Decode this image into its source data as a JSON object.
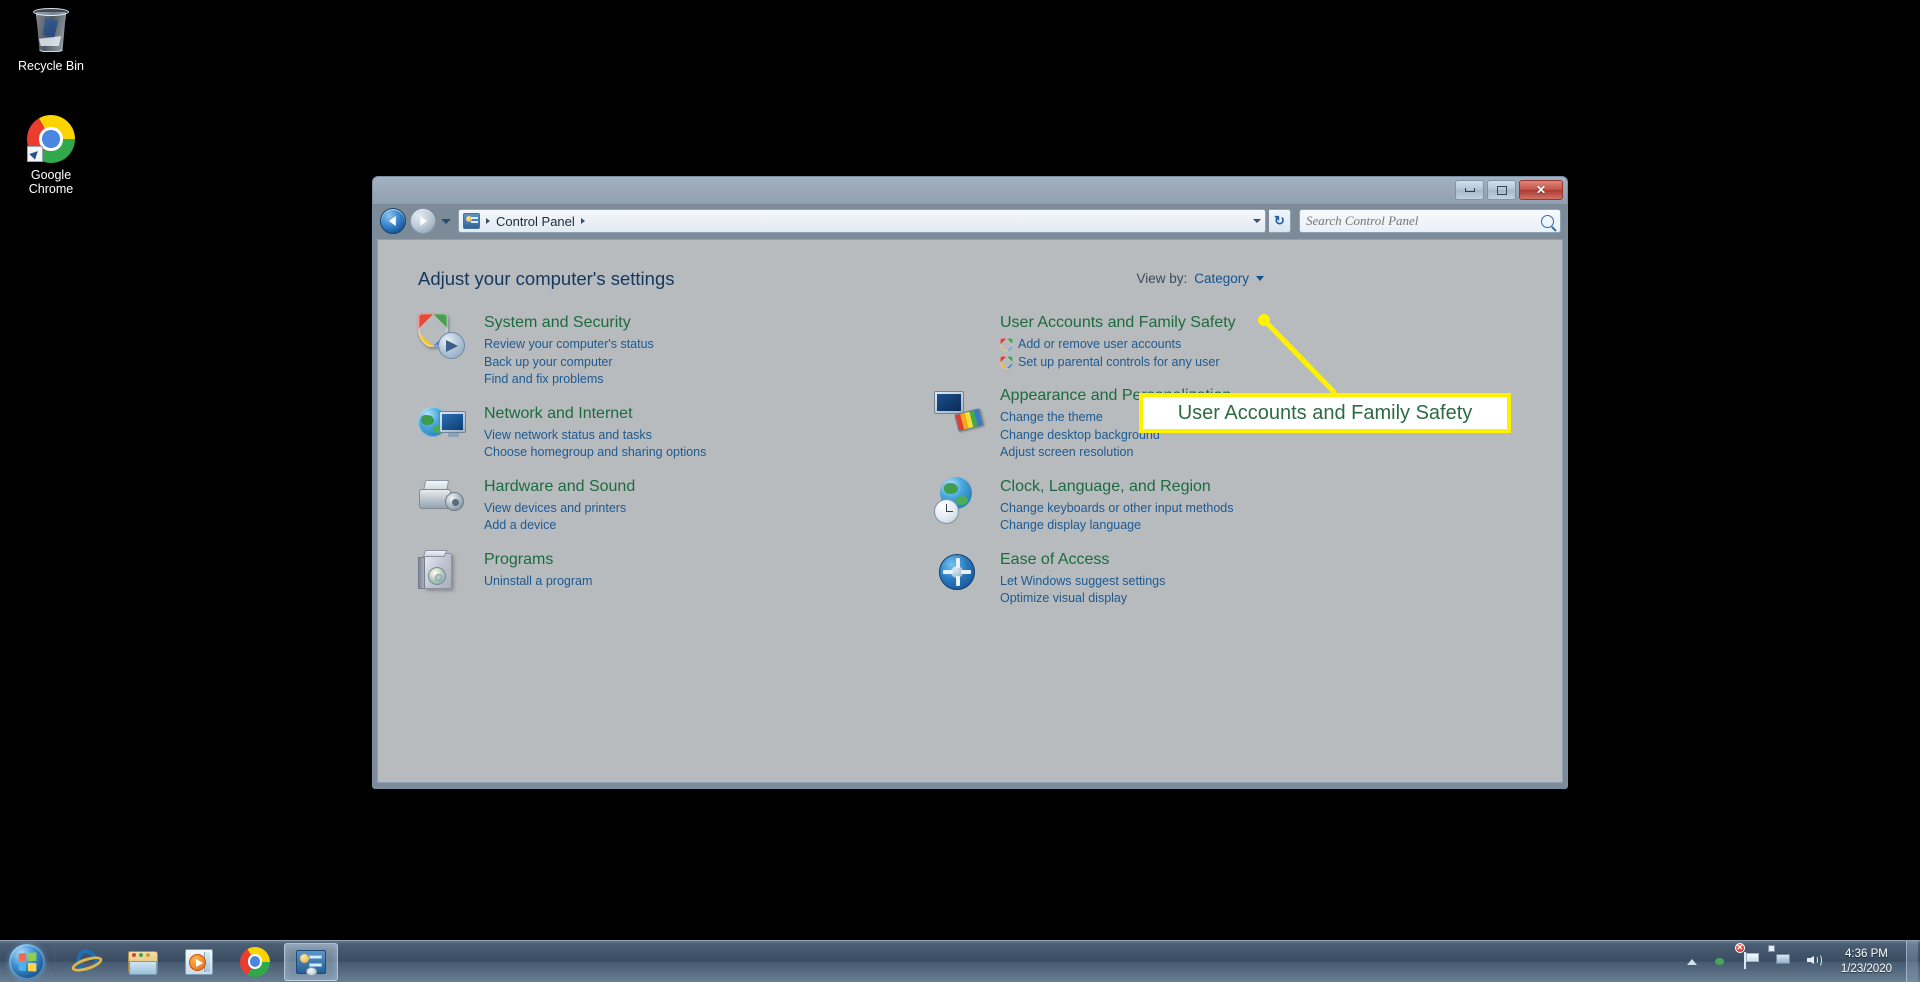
{
  "desktop": {
    "icons": [
      {
        "name": "recycle-bin",
        "label": "Recycle Bin"
      },
      {
        "name": "google-chrome",
        "label": "Google\nChrome",
        "line1": "Google",
        "line2": "Chrome"
      }
    ]
  },
  "window": {
    "titlebar": {
      "minimize_label": "—",
      "maximize_label": "□",
      "close_label": "✕"
    },
    "address": {
      "root_crumb": "Control Panel",
      "refresh_label": "↻"
    },
    "search": {
      "placeholder": "Search Control Panel"
    },
    "page_title": "Adjust your computer's settings",
    "view_by": {
      "label": "View by:",
      "value": "Category"
    },
    "categories_left": [
      {
        "icon": "system-and-security-icon",
        "title": "System and Security",
        "links": [
          {
            "text": "Review your computer's status",
            "shield": false
          },
          {
            "text": "Back up your computer",
            "shield": false
          },
          {
            "text": "Find and fix problems",
            "shield": false
          }
        ]
      },
      {
        "icon": "network-and-internet-icon",
        "title": "Network and Internet",
        "links": [
          {
            "text": "View network status and tasks",
            "shield": false
          },
          {
            "text": "Choose homegroup and sharing options",
            "shield": false
          }
        ]
      },
      {
        "icon": "hardware-and-sound-icon",
        "title": "Hardware and Sound",
        "links": [
          {
            "text": "View devices and printers",
            "shield": false
          },
          {
            "text": "Add a device",
            "shield": false
          }
        ]
      },
      {
        "icon": "programs-icon",
        "title": "Programs",
        "links": [
          {
            "text": "Uninstall a program",
            "shield": false
          }
        ]
      }
    ],
    "categories_right": [
      {
        "icon": "user-accounts-and-family-safety-icon",
        "title": "User Accounts and Family Safety",
        "links": [
          {
            "text": "Add or remove user accounts",
            "shield": true
          },
          {
            "text": "Set up parental controls for any user",
            "shield": true
          }
        ]
      },
      {
        "icon": "appearance-and-personalization-icon",
        "title": "Appearance and Personalization",
        "links": [
          {
            "text": "Change the theme",
            "shield": false
          },
          {
            "text": "Change desktop background",
            "shield": false
          },
          {
            "text": "Adjust screen resolution",
            "shield": false
          }
        ]
      },
      {
        "icon": "clock-language-and-region-icon",
        "title": "Clock, Language, and Region",
        "links": [
          {
            "text": "Change keyboards or other input methods",
            "shield": false
          },
          {
            "text": "Change display language",
            "shield": false
          }
        ]
      },
      {
        "icon": "ease-of-access-icon",
        "title": "Ease of Access",
        "links": [
          {
            "text": "Let Windows suggest settings",
            "shield": false
          },
          {
            "text": "Optimize visual display",
            "shield": false
          }
        ]
      }
    ]
  },
  "callout": {
    "text": "User Accounts and Family Safety",
    "border_color": "#fff200",
    "text_color": "#2c6b45",
    "background_color": "#ffffff"
  },
  "taskbar": {
    "start_label": "Start",
    "pinned": [
      {
        "name": "internet-explorer",
        "label": "Internet Explorer"
      },
      {
        "name": "windows-explorer",
        "label": "Windows Explorer"
      },
      {
        "name": "windows-media-player",
        "label": "Windows Media Player"
      },
      {
        "name": "google-chrome",
        "label": "Google Chrome"
      }
    ],
    "open_windows": [
      {
        "name": "control-panel",
        "label": "Control Panel",
        "active": true
      }
    ],
    "tray": {
      "action_center_badge": "✕",
      "time": "4:36 PM",
      "date": "1/23/2020"
    }
  },
  "colors": {
    "desktop_background": "#000000",
    "window_content": "#b7bbbd",
    "category_title": "#1c6b3f",
    "category_link": "#1d5a93",
    "page_title": "#14375e",
    "taskbar": "#3c5066"
  }
}
